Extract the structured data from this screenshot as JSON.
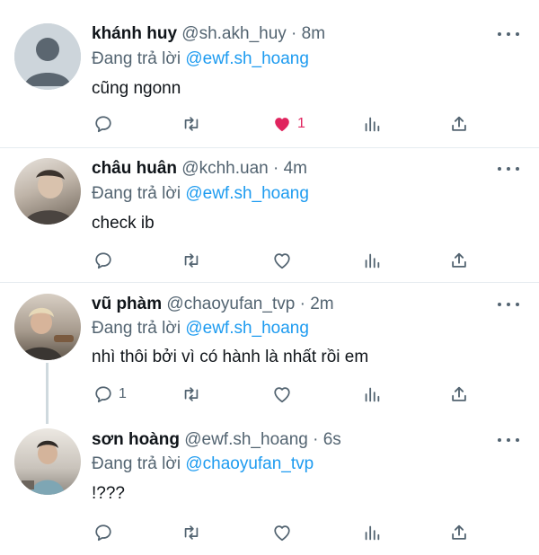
{
  "reply_to_label": "Đang trả lời",
  "tweets": [
    {
      "name": "khánh huy",
      "handle": "@sh.akh_huy",
      "time": "8m",
      "reply_to": "@ewf.sh_hoang",
      "text": "cũng ngonn",
      "avatar": "default-avatar",
      "reply_count": "",
      "like_count": "1",
      "liked": true
    },
    {
      "name": "châu huân",
      "handle": "@kchh.uan",
      "time": "4m",
      "reply_to": "@ewf.sh_hoang",
      "text": "check ib",
      "avatar": "photo-avatar",
      "reply_count": "",
      "like_count": "",
      "liked": false
    },
    {
      "name": "vũ phàm",
      "handle": "@chaoyufan_tvp",
      "time": "2m",
      "reply_to": "@ewf.sh_hoang",
      "text": "nhì thôi bởi vì có hành là nhất rồi em",
      "avatar": "photo-avatar",
      "reply_count": "1",
      "like_count": "",
      "liked": false
    },
    {
      "name": "sơn hoàng",
      "handle": "@ewf.sh_hoang",
      "time": "6s",
      "reply_to": "@chaoyufan_tvp",
      "text": "!???",
      "avatar": "photo-avatar",
      "reply_count": "",
      "like_count": "",
      "liked": false
    }
  ],
  "colors": {
    "accent": "#1d9bf0",
    "like": "#e0245e",
    "muted": "#536471",
    "divider": "#e6ecf0"
  }
}
